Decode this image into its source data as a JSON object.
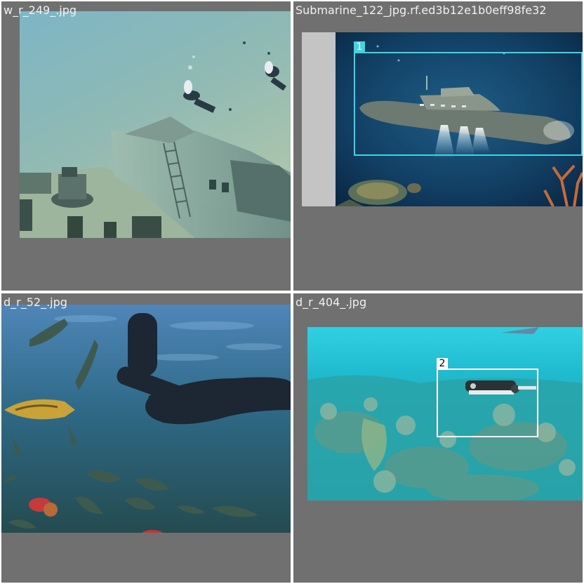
{
  "tiles": [
    {
      "filename": "w_r_249_.jpg"
    },
    {
      "filename": "Submarine_122_jpg.rf.ed3b12e1b0eff98fe32"
    },
    {
      "filename": "d_r_52_.jpg"
    },
    {
      "filename": "d_r_404_.jpg"
    }
  ],
  "detections": {
    "submarine": {
      "label": "1",
      "color": "#3fd4e6"
    },
    "rov": {
      "label": "2",
      "color": "#ffffff"
    }
  },
  "colors": {
    "tile_background": "#707070",
    "label_text": "#f0f0f0"
  }
}
